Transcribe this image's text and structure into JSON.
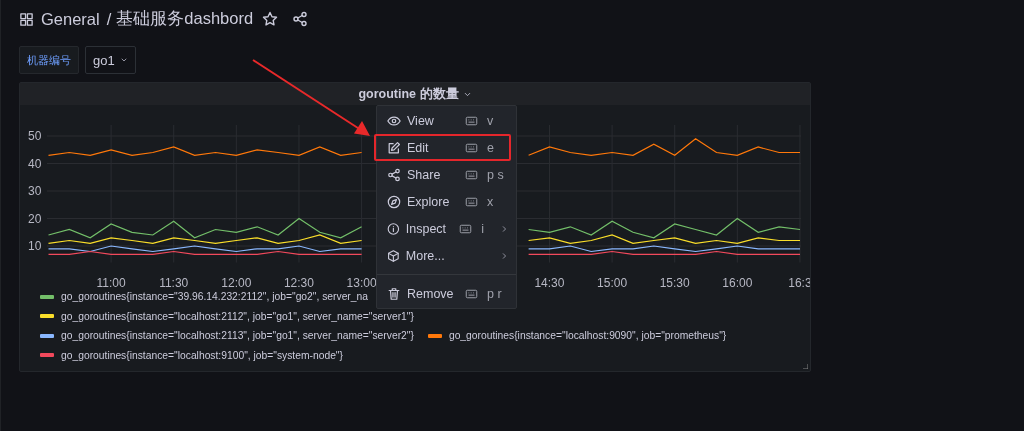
{
  "breadcrumb": {
    "folder": "General",
    "separator": "/",
    "title": "基础服务dashbord"
  },
  "variables": [
    {
      "label": "机器编号",
      "value": "go1"
    }
  ],
  "panel": {
    "title": "goroutine 的数量",
    "chart_data": {
      "type": "line",
      "categories": [
        null,
        null,
        null,
        "11:00",
        null,
        null,
        "11:30",
        null,
        null,
        "12:00",
        null,
        null,
        "12:30",
        null,
        null,
        "13:00",
        null,
        null,
        null,
        null,
        null,
        null,
        null,
        null,
        "14:30",
        null,
        null,
        "15:00",
        null,
        null,
        "15:30",
        null,
        null,
        "16:00",
        null,
        null,
        "16:3"
      ],
      "ylim": [
        4,
        54
      ],
      "grid": true,
      "yticks": [
        10,
        20,
        30,
        40,
        50
      ],
      "series": [
        {
          "color": "#73bf69",
          "values": [
            14,
            16,
            13,
            18,
            15,
            14,
            19,
            13,
            16,
            15,
            17,
            14,
            20,
            15,
            13,
            17,
            null,
            null,
            null,
            null,
            null,
            null,
            null,
            16,
            15,
            17,
            14,
            19,
            15,
            13,
            18,
            16,
            14,
            20,
            15,
            17,
            16
          ]
        },
        {
          "color": "#fade2a",
          "values": [
            11,
            12,
            11,
            13,
            12,
            11,
            13,
            12,
            11,
            12,
            13,
            11,
            12,
            14,
            11,
            12,
            null,
            null,
            null,
            null,
            null,
            null,
            null,
            12,
            13,
            11,
            12,
            14,
            11,
            12,
            13,
            11,
            12,
            11,
            13,
            12,
            12
          ]
        },
        {
          "color": "#8ab8ff",
          "values": [
            9,
            9,
            8,
            10,
            9,
            8,
            9,
            10,
            9,
            8,
            9,
            9,
            10,
            8,
            9,
            9,
            null,
            null,
            null,
            null,
            null,
            null,
            null,
            9,
            9,
            10,
            8,
            9,
            9,
            10,
            9,
            8,
            9,
            10,
            9,
            9,
            9
          ]
        },
        {
          "color": "#ff780a",
          "values": [
            43,
            44,
            43,
            45,
            43,
            44,
            46,
            43,
            44,
            43,
            45,
            44,
            43,
            46,
            43,
            44,
            null,
            null,
            null,
            null,
            null,
            null,
            null,
            43,
            46,
            44,
            43,
            44,
            43,
            47,
            43,
            49,
            44,
            43,
            46,
            44,
            44
          ]
        },
        {
          "color": "#f2495c",
          "values": [
            7,
            7,
            8,
            7,
            7,
            7,
            8,
            7,
            7,
            7,
            7,
            8,
            7,
            7,
            7,
            7,
            null,
            null,
            null,
            null,
            null,
            null,
            null,
            7,
            7,
            7,
            7,
            8,
            7,
            7,
            7,
            7,
            8,
            7,
            7,
            7,
            7
          ]
        }
      ]
    },
    "legend_rows": [
      [
        {
          "text": "go_goroutines{instance=\"39.96.14.232:2112\", job=\"go2\", server_na",
          "color": "#73bf69"
        }
      ],
      [
        {
          "text": "go_goroutines{instance=\"localhost:2112\", job=\"go1\", server_name=\"server1\"}",
          "color": "#fade2a"
        }
      ],
      [
        {
          "text": "go_goroutines{instance=\"localhost:2113\", job=\"go1\", server_name=\"server2\"}",
          "color": "#8ab8ff"
        },
        {
          "text": "go_goroutines{instance=\"localhost:9090\", job=\"prometheus\"}",
          "color": "#ff780a"
        }
      ],
      [
        {
          "text": "go_goroutines{instance=\"localhost:9100\", job=\"system-node\"}",
          "color": "#f2495c"
        }
      ]
    ]
  },
  "menu": [
    {
      "kind": "item",
      "label": "View",
      "shortcut": "v",
      "submenu": false,
      "highlighted": false
    },
    {
      "kind": "item",
      "label": "Edit",
      "shortcut": "e",
      "submenu": false,
      "highlighted": true
    },
    {
      "kind": "item",
      "label": "Share",
      "shortcut": "p s",
      "submenu": false,
      "highlighted": false
    },
    {
      "kind": "item",
      "label": "Explore",
      "shortcut": "x",
      "submenu": false,
      "highlighted": false
    },
    {
      "kind": "item",
      "label": "Inspect",
      "shortcut": "i",
      "submenu": true,
      "highlighted": false
    },
    {
      "kind": "item",
      "label": "More...",
      "submenu": true,
      "highlighted": false
    },
    {
      "kind": "divider"
    },
    {
      "kind": "item",
      "label": "Remove",
      "shortcut": "p r",
      "submenu": false,
      "highlighted": false
    }
  ]
}
